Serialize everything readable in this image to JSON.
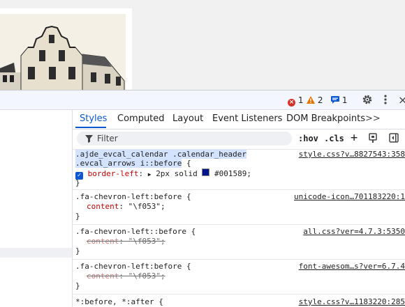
{
  "status_bar": {
    "errors": "1",
    "warnings": "2",
    "messages": "1"
  },
  "tabs": [
    {
      "label": "Styles",
      "active": true
    },
    {
      "label": "Computed"
    },
    {
      "label": "Layout"
    },
    {
      "label": "Event Listeners"
    },
    {
      "label": "DOM Breakpoints"
    }
  ],
  "tabs_overflow": ">>",
  "filter": {
    "placeholder": "Filter",
    "hov": ":hov",
    ".cls": ".cls"
  },
  "colors": {
    "accent": "#0b57d0",
    "error": "#d93025",
    "warning": "#e37400",
    "swatch": "#001589"
  },
  "rules": [
    {
      "selector_line1": ".ajde_evcal_calendar .calendar_header",
      "selector_line2": ".evcal_arrows i::before",
      "source": "style.css?v…8827543:358",
      "property": "border-left",
      "value": "2px solid",
      "color_value": "#001589"
    },
    {
      "selector": ".fa-chevron-left:before {",
      "source": "unicode-icon…701183220:1",
      "property": "content",
      "value": "\"\\f053\";"
    },
    {
      "selector": ".fa-chevron-left::before {",
      "source": "all.css?ver=4.7.3:5350",
      "property": "content",
      "value": "\"\\f053\";"
    },
    {
      "selector": ".fa-chevron-left:before {",
      "source": "font-awesom…s?ver=6.7.4",
      "property": "content",
      "value": "\"\\f053\";"
    },
    {
      "selector": "*:before, *:after {",
      "source": "style.css?v…1183220:285"
    }
  ]
}
